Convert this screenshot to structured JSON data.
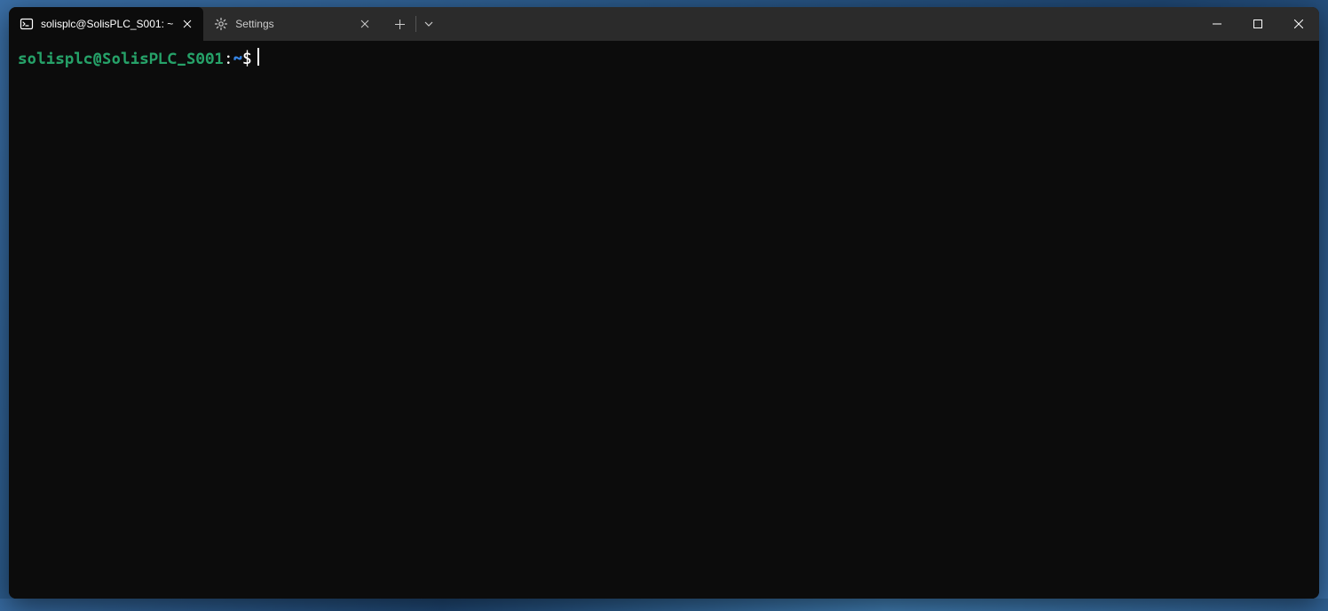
{
  "tabs": [
    {
      "label": "solisplc@SolisPLC_S001: ~",
      "icon": "terminal-icon",
      "active": true
    },
    {
      "label": "Settings",
      "icon": "gear-icon",
      "active": false
    }
  ],
  "prompt": {
    "user_host": "solisplc@SolisPLC_S001",
    "colon": ":",
    "path": "~",
    "symbol": "$"
  },
  "colors": {
    "bg": "#0c0c0c",
    "titlebar": "#2b2b2b",
    "prompt_green": "#26a269",
    "prompt_blue": "#3584e4",
    "text": "#ffffff"
  }
}
